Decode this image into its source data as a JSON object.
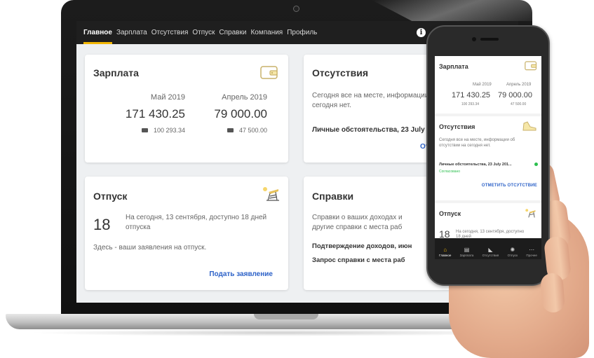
{
  "nav": {
    "items": [
      "Главное",
      "Зарплата",
      "Отсутствия",
      "Отпуск",
      "Справки",
      "Компания",
      "Профиль"
    ],
    "active_index": 0
  },
  "salary": {
    "title": "Зарплата",
    "current": {
      "month": "Май 2019",
      "amount": "171 430.25",
      "sub": "100 293.34"
    },
    "previous": {
      "month": "Апрель 2019",
      "amount": "79 000.00",
      "sub": "47 500.00"
    }
  },
  "absence": {
    "title": "Отсутствия",
    "text": "Сегодня все на месте, информации сегодня нет.",
    "item": "Личные обстоятельства, 23 July ...",
    "link_partial": "От"
  },
  "vacation": {
    "title": "Отпуск",
    "days": "18",
    "text": "На сегодня, 13 сентября, доступно 18 дней отпуска",
    "note": "Здесь - ваши заявления на отпуск.",
    "link": "Подать заявление"
  },
  "refs": {
    "title": "Справки",
    "text": "Справки о ваших доходах и другие справки с места раб",
    "item1": "Подтверждение доходов, июн",
    "item2": "Запрос справки с места раб"
  },
  "phone": {
    "salary": {
      "title": "Зарплата",
      "m1": "Май 2019",
      "a1": "171 430.25",
      "s1": "100 293.34",
      "m2": "Апрель 2019",
      "a2": "79 000.00",
      "s2": "47 500.00"
    },
    "absence": {
      "title": "Отсутствия",
      "text": "Сегодня все на месте, информации об отсутствии на сегодня нет.",
      "item": "Личные обстоятельства, 23 July 201...",
      "status": "Согласовано",
      "action": "ОТМЕТИТЬ ОТСУТСТВИЕ"
    },
    "vacation": {
      "title": "Отпуск",
      "days": "18",
      "text": "На сегодня, 13 сентября, доступно 18 дней"
    },
    "tabs": [
      "Главное",
      "Зарплата",
      "Отсутствия",
      "Отпуск",
      "Прочее"
    ],
    "active_tab": 0
  },
  "colors": {
    "accent": "#f2b705",
    "link": "#2d62c8",
    "status_green": "#2bbf4e",
    "nav_bg": "#1f1f1f"
  }
}
